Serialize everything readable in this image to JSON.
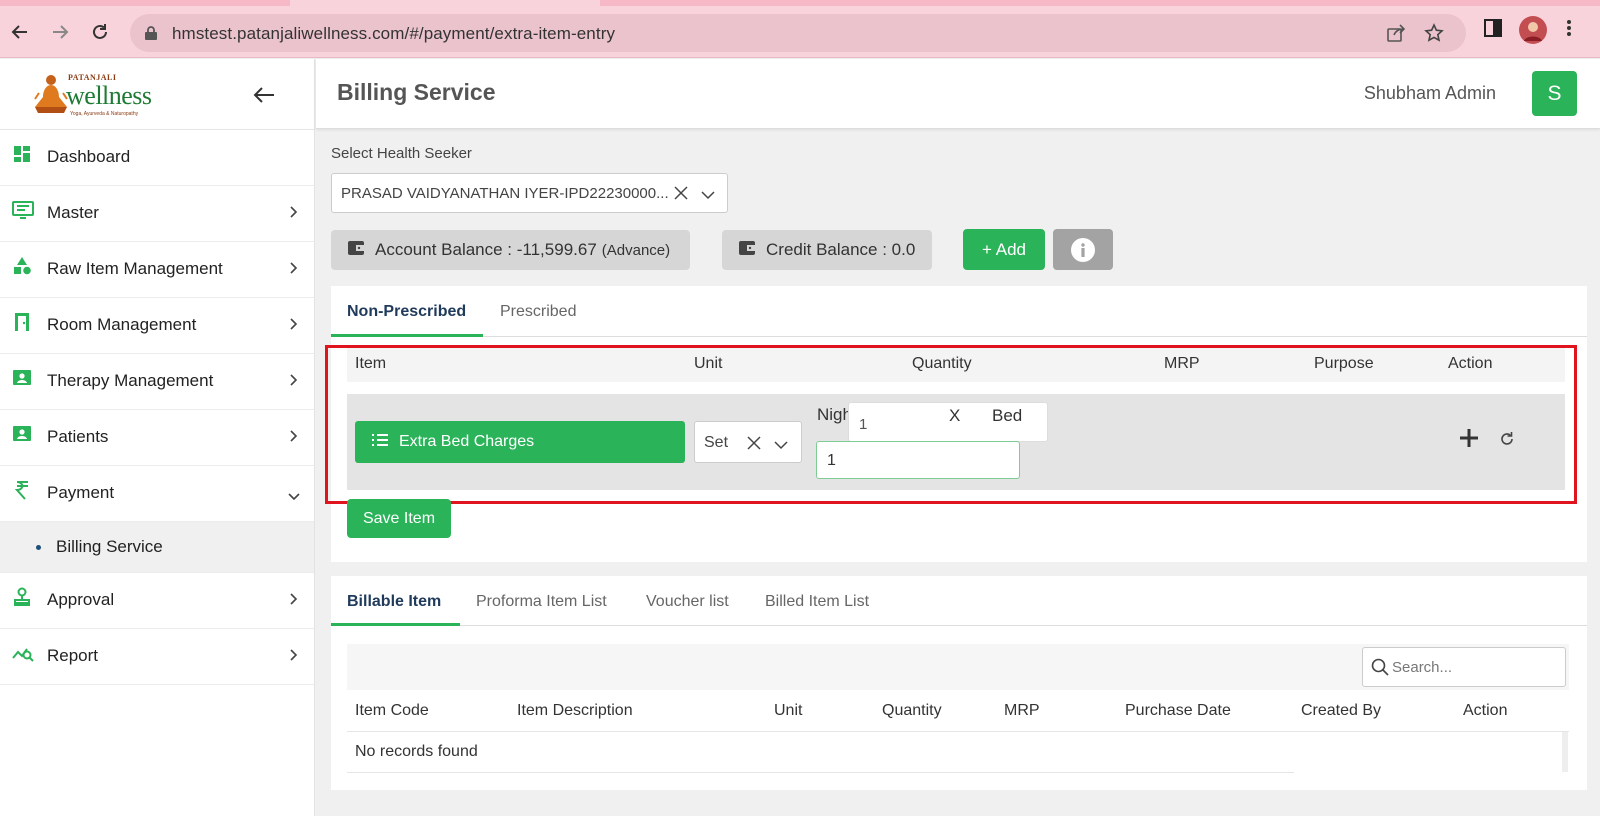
{
  "browser": {
    "url": "hmstest.patanjaliwellness.com/#/payment/extra-item-entry"
  },
  "brand": {
    "logo_small": "PATANJALI",
    "logo_big": "wellness",
    "logo_tag": "Yoga, Ayurveda & Naturopathy"
  },
  "sidebar": {
    "items": [
      {
        "label": "Dashboard",
        "icon": "dashboard-icon"
      },
      {
        "label": "Master",
        "icon": "master-icon"
      },
      {
        "label": "Raw Item Management",
        "icon": "shapes-icon"
      },
      {
        "label": "Room Management",
        "icon": "door-icon"
      },
      {
        "label": "Therapy Management",
        "icon": "id-badge-icon"
      },
      {
        "label": "Patients",
        "icon": "id-badge-icon"
      },
      {
        "label": "Payment",
        "icon": "rupee-icon"
      },
      {
        "label": "Approval",
        "icon": "stamp-icon"
      },
      {
        "label": "Report",
        "icon": "chart-search-icon"
      }
    ],
    "submenu_label": "Billing Service"
  },
  "header": {
    "title": "Billing Service",
    "user_name": "Shubham Admin",
    "avatar_letter": "S"
  },
  "seeker": {
    "label": "Select Health Seeker",
    "value": "PRASAD VAIDYANATHAN IYER-IPD22230000..."
  },
  "balances": {
    "account_text": "Account Balance : -11,599.67",
    "account_sub": "(Advance)",
    "credit_text": "Credit Balance : 0.0"
  },
  "buttons": {
    "add": "+ Add",
    "save_item": "Save Item"
  },
  "tabs_top": [
    "Non-Prescribed",
    "Prescribed"
  ],
  "entry": {
    "headers": [
      "Item",
      "Unit",
      "Quantity",
      "MRP",
      "Purpose",
      "Action"
    ],
    "item_label": "Extra Bed Charges",
    "unit_value": "Set",
    "qty_label": "Nights",
    "qty_box_value": "1",
    "qty_multiplier": "X",
    "qty_bed": "Bed",
    "qty_input_value": "1"
  },
  "tabs_bottom": [
    "Billable Item",
    "Proforma Item List",
    "Voucher list",
    "Billed Item List"
  ],
  "bill_table": {
    "search_placeholder": "Search...",
    "headers": [
      "Item Code",
      "Item Description",
      "Unit",
      "Quantity",
      "MRP",
      "Purchase Date",
      "Created By",
      "Action"
    ],
    "empty_message": "No records found"
  },
  "colors": {
    "accent_green": "#2bb35a",
    "highlight_red": "#e0141e",
    "chrome_pink": "#f9d3dc"
  }
}
